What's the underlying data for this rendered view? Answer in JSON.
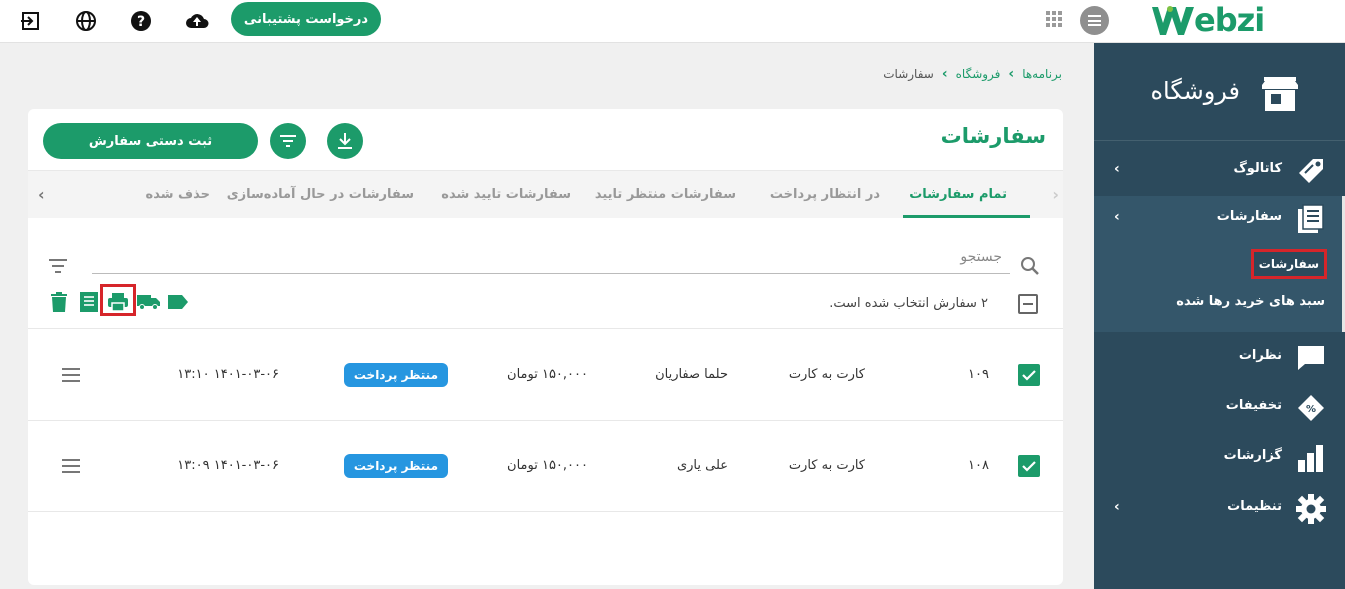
{
  "topbar": {
    "logo_text": "ebzi",
    "support_label": "درخواست پشتیبانی",
    "icons": [
      "logout-icon",
      "globe-icon",
      "help-icon",
      "cloud-upload-icon",
      "apps-grid-icon",
      "menu-icon"
    ]
  },
  "sidebar": {
    "store_label": "فروشگاه",
    "items": [
      {
        "label": "کاتالوگ",
        "icon": "tag-icon"
      },
      {
        "label": "سفارشات",
        "icon": "orders-icon"
      },
      {
        "label": "نظرات",
        "icon": "comment-icon"
      },
      {
        "label": "تخفیفات",
        "icon": "coupon-icon"
      },
      {
        "label": "گزارشات",
        "icon": "bar-chart-icon"
      },
      {
        "label": "تنظیمات",
        "icon": "gear-icon"
      }
    ],
    "sub_items": [
      {
        "label": "سفارشات"
      },
      {
        "label": "سبد های خرید رها شده"
      }
    ]
  },
  "breadcrumb": [
    "برنامه‌ها",
    "فروشگاه",
    "سفارشات"
  ],
  "page": {
    "title": "سفارشات",
    "manual_order_label": "ثبت دستی سفارش"
  },
  "tabs": [
    {
      "label": "تمام سفارشات"
    },
    {
      "label": "در انتظار پرداخت"
    },
    {
      "label": "سفارشات منتظر تایید"
    },
    {
      "label": "سفارشات تایید شده"
    },
    {
      "label": "سفارشات در حال آماده‌سازی"
    },
    {
      "label": "حذف شده"
    }
  ],
  "search": {
    "placeholder": "جستجو"
  },
  "selection": {
    "text": "۲ سفارش انتخاب شده است."
  },
  "orders": [
    {
      "id": "۱۰۹",
      "payment": "کارت به کارت",
      "customer": "حلما صفاریان",
      "amount": "۱۵۰,۰۰۰ تومان",
      "status": "منتظر پرداخت",
      "datetime": "۱۴۰۱-۰۳-۰۶ ۱۳:۱۰"
    },
    {
      "id": "۱۰۸",
      "payment": "کارت به کارت",
      "customer": "علی یاری",
      "amount": "۱۵۰,۰۰۰ تومان",
      "status": "منتظر پرداخت",
      "datetime": "۱۴۰۱-۰۳-۰۶ ۱۳:۰۹"
    }
  ],
  "colors": {
    "brand": "#1c9b6a",
    "sidebar": "#2c4a5c",
    "badge": "#2696e0",
    "highlight": "#d6252a"
  }
}
